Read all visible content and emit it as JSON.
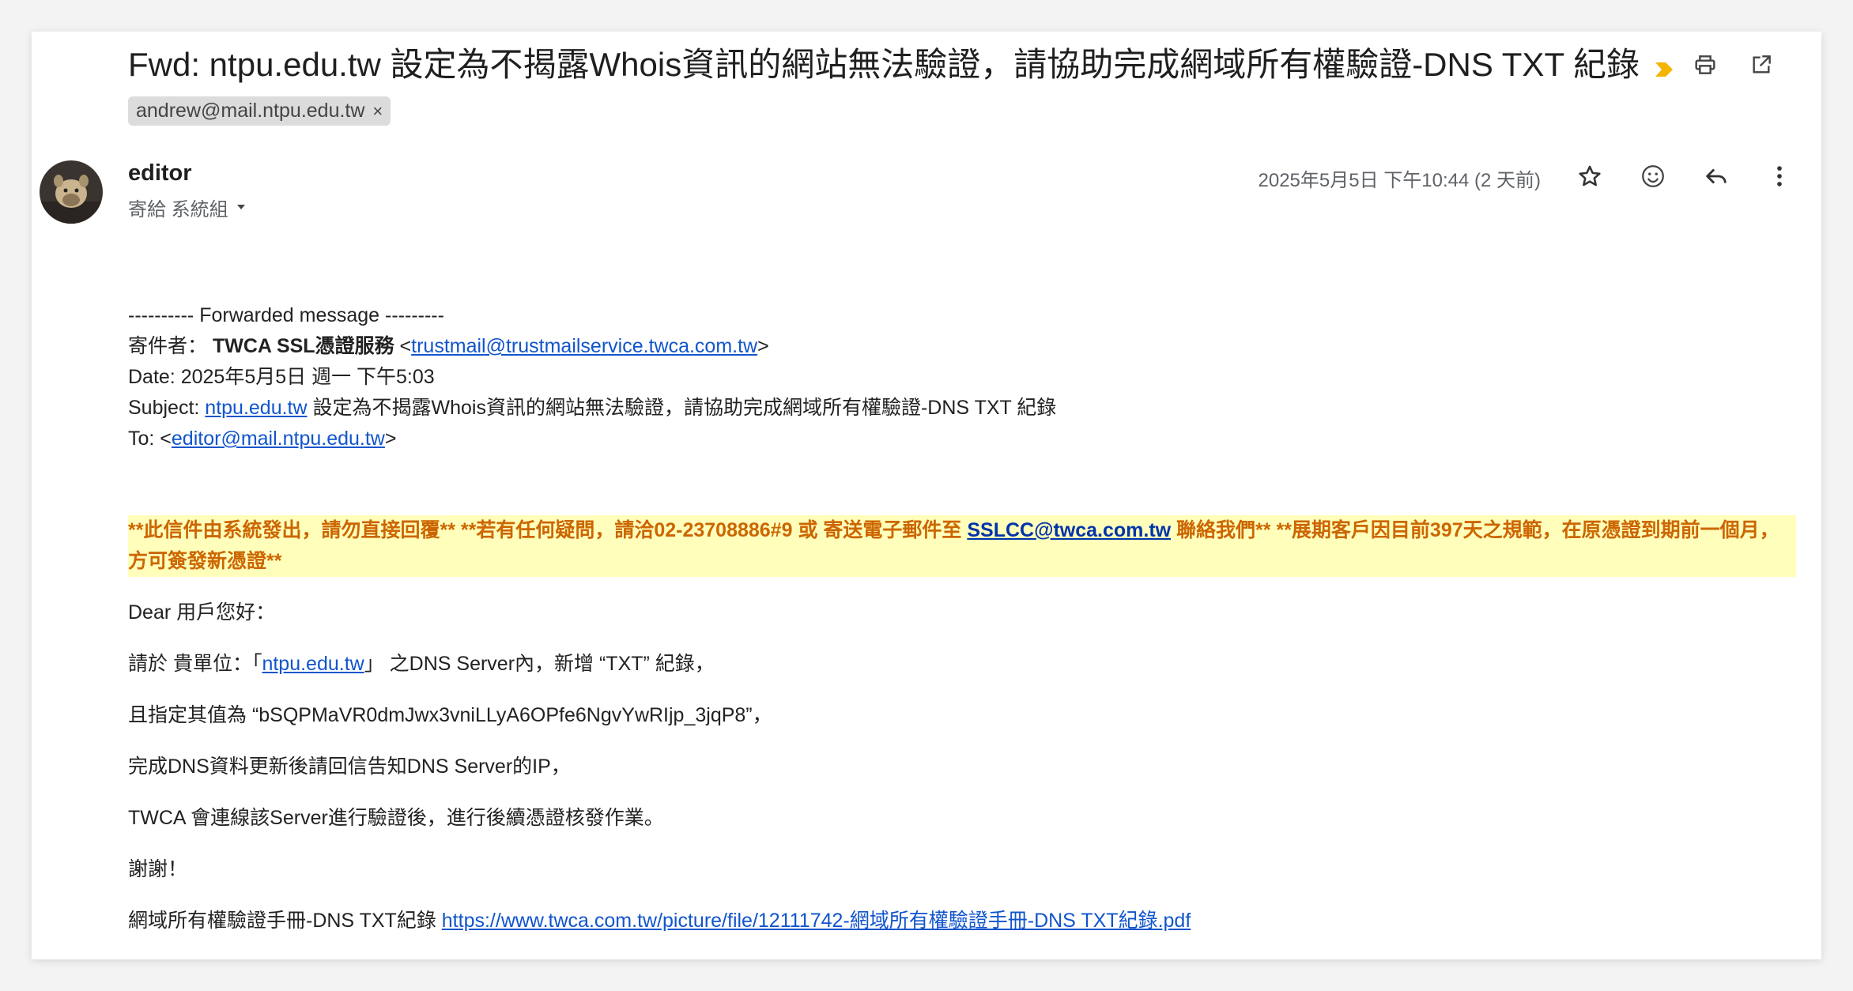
{
  "email": {
    "subject": "Fwd: ntpu.edu.tw 設定為不揭露Whois資訊的網站無法驗證，請協助完成網域所有權驗證-DNS TXT 紀錄",
    "label_chip": "andrew@mail.ntpu.edu.tw",
    "label_chip_close": "×",
    "sender_name": "editor",
    "to_label": "寄給 系統組",
    "date": "2025年5月5日 下午10:44 (2 天前)"
  },
  "forwarded": {
    "header": "---------- Forwarded message ---------",
    "from_label": "寄件者：",
    "from_name": "TWCA SSL憑證服務",
    "from_email": "trustmail@trustmailservice.twca.com.tw",
    "date_line": "Date: 2025年5月5日 週一 下午5:03",
    "subject_label": "Subject:",
    "subject_link": "ntpu.edu.tw",
    "subject_rest": "設定為不揭露Whois資訊的網站無法驗證，請協助完成網域所有權驗證-DNS TXT 紀錄",
    "to_label": "To:",
    "to_email": "editor@mail.ntpu.edu.tw"
  },
  "notice": {
    "part1": "**此信件由系統發出，請勿直接回覆** **若有任何疑問，請洽02-23708886#9 或 寄送電子郵件至 ",
    "email": "SSLCC@twca.com.tw",
    "part2": " 聯絡我們** **展期客戶因目前397天之規範，在原憑證到期前一個月，方可簽發新憑證**"
  },
  "body": {
    "greeting": "Dear 用戶您好：",
    "line1_pre": "請於 貴單位：「",
    "line1_link": "ntpu.edu.tw",
    "line1_post": "」 之DNS Server內，新增 “TXT” 紀錄，",
    "line2": "且指定其值為 “bSQPMaVR0dmJwx3vniLLyA6OPfe6NgvYwRIjp_3jqP8”，",
    "line3": "完成DNS資料更新後請回信告知DNS Server的IP，",
    "line4": "TWCA 會連線該Server進行驗證後，進行後續憑證核發作業。",
    "thanks": "謝謝！",
    "manual_label": "網域所有權驗證手冊-DNS TXT紀錄",
    "manual_link": "https://www.twca.com.tw/picture/file/12111742-網域所有權驗證手冊-DNS TXT紀錄.pdf"
  },
  "icons": {
    "print": "print-icon",
    "open_new_window": "open-in-new-window-icon",
    "star": "star-icon",
    "emoji": "emoji-reaction-icon",
    "reply": "reply-icon",
    "more": "more-vert-icon",
    "label_arrow": "label-importance-icon",
    "dropdown": "dropdown-arrow-icon"
  },
  "colors": {
    "link": "#1155cc",
    "notice_bg": "#ffffbb",
    "notice_text": "#cc6600",
    "importance_marker": "#f4b400"
  }
}
